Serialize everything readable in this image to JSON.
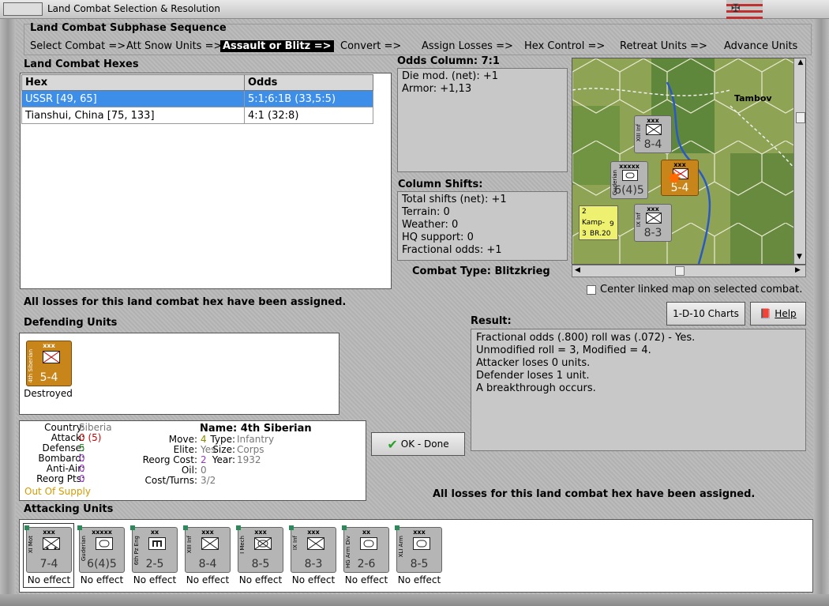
{
  "window": {
    "title": "Land Combat Selection & Resolution"
  },
  "sequence": {
    "title": "Land Combat Subphase Sequence",
    "steps": [
      "Select Combat =>",
      "Att Snow Units =>",
      "Assault or Blitz =>",
      "Convert =>",
      "Assign Losses =>",
      "Hex Control =>",
      "Retreat Units =>",
      "Advance Units"
    ],
    "active_index": 2
  },
  "land_combat": {
    "title": "Land Combat Hexes",
    "columns": [
      "Hex",
      "Odds"
    ],
    "rows": [
      {
        "hex": "USSR [49, 65]",
        "odds": "5:1;6:1B (33,5:5)"
      },
      {
        "hex": "Tianshui, China [75, 133]",
        "odds": "4:1 (32:8)"
      }
    ],
    "losses_msg": "All losses for this land combat hex have been assigned."
  },
  "odds": {
    "title": "Odds Column: 7:1",
    "lines": [
      "Die mod. (net): +1",
      "Armor: +1,13"
    ]
  },
  "shifts": {
    "title": "Column Shifts:",
    "lines": [
      "Total shifts (net): +1",
      "Terrain: 0",
      "Weather: 0",
      "HQ support: 0",
      "Fractional odds: +1"
    ]
  },
  "combat_type": "Combat Type:  Blitzkrieg",
  "map": {
    "city": "Tambov",
    "center_label": "Center linked map on selected combat.",
    "counters": [
      {
        "size": "xxx",
        "label": "XIII Inf",
        "value": "8-4",
        "stack": "3"
      },
      {
        "size": "xxxxx",
        "label": "Guderian",
        "value": "6(4)5",
        "stack": "2"
      },
      {
        "size": "xxx",
        "label": "4th Siberian",
        "value": "5-4"
      },
      {
        "size": "xxx",
        "label": "IX Inf",
        "value": "8-3",
        "stack": "3"
      },
      {
        "air": "2",
        "tag": "Kamp-",
        "num": "9",
        "base": "3",
        "model": "BR.20"
      }
    ]
  },
  "buttons": {
    "charts": "1-D-10 Charts",
    "help": "Help",
    "ok": "OK - Done"
  },
  "defending": {
    "title": "Defending Units",
    "units": [
      {
        "size": "xxx",
        "label": "4th Siberian",
        "value": "5-4",
        "status": "Destroyed"
      }
    ]
  },
  "unit_info": {
    "name_label": "Name:",
    "name": "4th Siberian",
    "country_label": "Country:",
    "country": "Siberia",
    "attack_label": "Attack:",
    "attack": "0",
    "attack_paren": "(5)",
    "defense_label": "Defense:",
    "defense": "5",
    "bombard_label": "Bombard:",
    "bombard": "0",
    "antiair_label": "Anti-Air:",
    "antiair": "0",
    "reorg_label": "Reorg Pts:",
    "reorg": "0",
    "supply": "Out Of Supply",
    "move_label": "Move:",
    "move": "4",
    "elite_label": "Elite:",
    "elite": "Yes",
    "reorgcost_label": "Reorg Cost:",
    "reorgcost": "2",
    "oil_label": "Oil:",
    "oil": "0",
    "costturns_label": "Cost/Turns:",
    "costturns": "3/2",
    "type_label": "Type:",
    "type": "Infantry",
    "size_label": "Size:",
    "size": "Corps",
    "year_label": "Year:",
    "year": "1932"
  },
  "result": {
    "title": "Result:",
    "lines": [
      "Fractional odds (.800) roll was (.072)  - Yes.",
      "Unmodified roll = 3, Modified = 4.",
      "Attacker loses 0 units.",
      "Defender loses 1 unit.",
      "A breakthrough occurs."
    ],
    "losses_msg": "All losses for this land combat hex have been assigned."
  },
  "attacking": {
    "title": "Attacking Units",
    "units": [
      {
        "size": "xxx",
        "label": "XI Mot",
        "value": "7-4",
        "status": "No effect"
      },
      {
        "size": "xxxxx",
        "label": "Guderian",
        "value": "6(4)5",
        "status": "No effect"
      },
      {
        "size": "xx",
        "label": "6th Pz Eng",
        "value": "2-5",
        "status": "No effect"
      },
      {
        "size": "xxx",
        "label": "XIII Inf",
        "value": "8-4",
        "status": "No effect"
      },
      {
        "size": "xxx",
        "label": "I Mech",
        "value": "8-5",
        "status": "No effect"
      },
      {
        "size": "xxx",
        "label": "IX Inf",
        "value": "8-3",
        "status": "No effect"
      },
      {
        "size": "xx",
        "label": "HG Arm Div",
        "value": "2-6",
        "status": "No effect"
      },
      {
        "size": "xxx",
        "label": "XLI Arm",
        "value": "8-5",
        "status": "No effect"
      }
    ]
  },
  "colors": {
    "selected_row": "#3d8ee8",
    "attack_red": "#cc0000",
    "defense_green": "#228822",
    "bombard_purple": "#9933cc",
    "supply_orange": "#d49a00",
    "counter_orange": "#c8861a"
  }
}
